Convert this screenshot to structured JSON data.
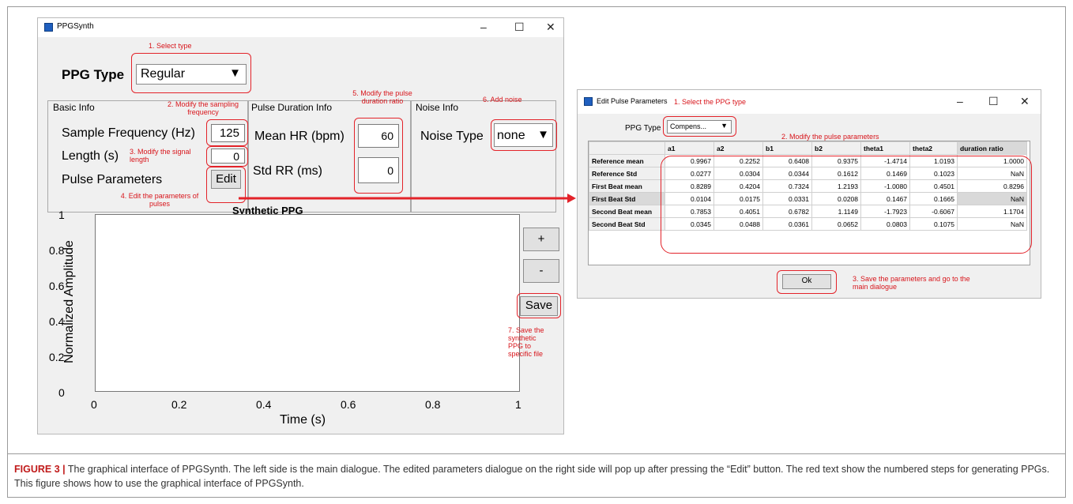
{
  "main": {
    "title": "PPGSynth",
    "window_controls": {
      "minimize": "–",
      "maximize": "☐",
      "close": "✕"
    },
    "ppg_type_label": "PPG Type",
    "ppg_type_value": "Regular",
    "panels": {
      "basic": "Basic Info",
      "pulse": "Pulse Duration Info",
      "noise": "Noise Info"
    },
    "sample_freq_label": "Sample Frequency (Hz)",
    "sample_freq_value": "125",
    "length_label": "Length (s)",
    "length_value": "0",
    "pulse_params_label": "Pulse Parameters",
    "edit_button": "Edit",
    "mean_hr_label": "Mean HR (bpm)",
    "mean_hr_value": "60",
    "std_rr_label": "Std RR (ms)",
    "std_rr_value": "0",
    "noise_type_label": "Noise Type",
    "noise_type_value": "none",
    "plus_button": "+",
    "minus_button": "-",
    "save_button": "Save",
    "plot": {
      "title": "Synthetic PPG",
      "xlabel": "Time (s)",
      "ylabel": "Normalized Amplitude",
      "xticks": [
        "0",
        "0.2",
        "0.4",
        "0.6",
        "0.8",
        "1"
      ],
      "yticks": [
        "0",
        "0.2",
        "0.4",
        "0.6",
        "0.8",
        "1"
      ]
    }
  },
  "annotations": {
    "a1": "1. Select type",
    "a2a": "2. Modify the sampling",
    "a2b": "frequency",
    "a3a": "3. Modify the signal",
    "a3b": "length",
    "a4a": "4. Edit the parameters of",
    "a4b": "pulses",
    "a5a": "5. Modify the pulse",
    "a5b": "duration ratio",
    "a6": "6. Add noise",
    "a7": [
      "7. Save the",
      "synthetic",
      "PPG to",
      "specific file"
    ],
    "d1": "1. Select the PPG type",
    "d2": "2. Modify the pulse parameters",
    "d3a": "3. Save the parameters and go to the",
    "d3b": "main dialogue"
  },
  "dialog": {
    "title": "Edit Pulse Parameters",
    "window_controls": {
      "minimize": "–",
      "maximize": "☐",
      "close": "✕"
    },
    "ppg_type_label": "PPG Type",
    "ppg_type_value": "Compens...",
    "ok_button": "Ok",
    "columns": [
      "a1",
      "a2",
      "b1",
      "b2",
      "theta1",
      "theta2",
      "duration ratio"
    ],
    "rows": [
      {
        "name": "Reference mean",
        "values": [
          "0.9967",
          "0.2252",
          "0.6408",
          "0.9375",
          "-1.4714",
          "1.0193",
          "1.0000"
        ]
      },
      {
        "name": "Reference Std",
        "values": [
          "0.0277",
          "0.0304",
          "0.0344",
          "0.1612",
          "0.1469",
          "0.1023",
          "NaN"
        ]
      },
      {
        "name": "First Beat mean",
        "values": [
          "0.8289",
          "0.4204",
          "0.7324",
          "1.2193",
          "-1.0080",
          "0.4501",
          "0.8296"
        ]
      },
      {
        "name": "First Beat Std",
        "values": [
          "0.0104",
          "0.0175",
          "0.0331",
          "0.0208",
          "0.1467",
          "0.1665",
          "NaN"
        ]
      },
      {
        "name": "Second Beat mean",
        "values": [
          "0.7853",
          "0.4051",
          "0.6782",
          "1.1149",
          "-1.7923",
          "-0.6067",
          "1.1704"
        ]
      },
      {
        "name": "Second Beat Std",
        "values": [
          "0.0345",
          "0.0488",
          "0.0361",
          "0.0652",
          "0.0803",
          "0.1075",
          "NaN"
        ]
      }
    ]
  },
  "caption": {
    "label": "FIGURE 3 |",
    "text": " The graphical interface of PPGSynth. The left side is the main dialogue. The edited parameters dialogue on the right side will pop up after pressing the “Edit” button. The red text show the numbered steps for generating PPGs. This figure shows how to use the graphical interface of PPGSynth."
  },
  "colors": {
    "annotation": "#d8151b",
    "arrow": "#e3232a",
    "caption_label": "#c01a1a"
  }
}
